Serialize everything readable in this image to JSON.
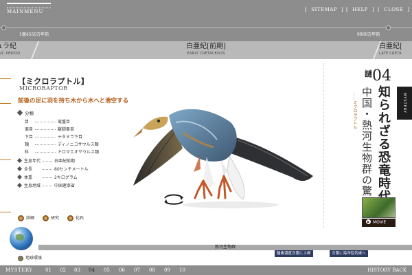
{
  "header": {
    "logo_text": "MAINMENU",
    "links": [
      "SITEMAP",
      "HELP",
      "CLOSE"
    ]
  },
  "timeline": {
    "left_label": "1億4550万年前",
    "right_label": "9960万年前"
  },
  "periods": {
    "left": {
      "name": "ュラ紀",
      "en": "ASIC PERIOD"
    },
    "center": {
      "name": "白亜紀[前期]",
      "en": "EARLY CRETACEOUS"
    },
    "right": {
      "name": "白亜紀[",
      "en": "LATE CRETA"
    }
  },
  "species": {
    "name": "【ミクロラプトル】",
    "en_name": "MICRORAPTOR",
    "tagline": "前後の足に羽を持ち木から木へと滑空する",
    "classification_heading": "分類",
    "classification": [
      {
        "label": "目",
        "value": "竜盤目"
      },
      {
        "label": "亜目",
        "value": "獣脚亜目"
      },
      {
        "label": "下目",
        "value": "テタヌラ下目"
      },
      {
        "label": "類",
        "value": "ディノニコサウルス類"
      },
      {
        "label": "科",
        "value": "ドロマエオサウルス類"
      }
    ],
    "info": [
      {
        "label": "生息年代",
        "value": "白亜紀前期"
      },
      {
        "label": "全長",
        "value": "80センチメートル"
      },
      {
        "label": "体重",
        "value": "2キログラム"
      },
      {
        "label": "生息地域",
        "value": "中国遼寧省"
      }
    ],
    "sub_buttons": [
      "詳細",
      "研究",
      "化石"
    ]
  },
  "mystery": {
    "number_kanji": "謎",
    "number": "04",
    "tab_label": "MYSTERY",
    "title": "知られざる恐竜時代",
    "subtitle": "中国・熱河生物群の驚異",
    "tag": "ミクロラプトル",
    "movie_label": "MOVIE"
  },
  "lower": {
    "fauna_label": "熱河生物群",
    "env_link": "地球環境",
    "events": [
      "酸素濃度次第に上昇",
      "次第に海洋性気候へ"
    ]
  },
  "bottom_nav": {
    "label": "MYSTERY",
    "numbers": [
      "01",
      "02",
      "03",
      "04",
      "05",
      "06",
      "07",
      "08",
      "09",
      "10"
    ],
    "active_index": 3,
    "history_back": "HISTORY BACK"
  },
  "colors": {
    "chrome_gray": "#8d8d8d",
    "period_gray": "#b9b9b9",
    "accent_orange": "#b15b14",
    "event_navy": "#2d3b63"
  }
}
